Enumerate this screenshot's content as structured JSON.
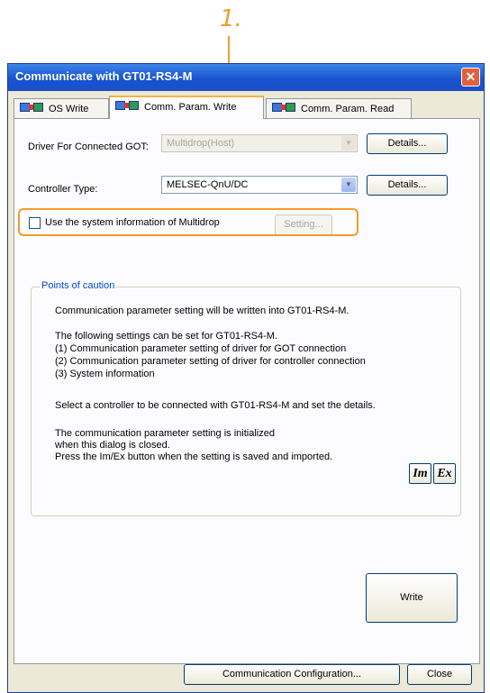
{
  "annotation": {
    "step": "1."
  },
  "window": {
    "title": "Communicate with GT01-RS4-M",
    "close_symbol": "✕"
  },
  "tabs": [
    {
      "label": "OS Write",
      "icon": "transfer-icon",
      "active": false
    },
    {
      "label": "Comm. Param. Write",
      "icon": "transfer-icon",
      "active": true
    },
    {
      "label": "Comm. Param. Read",
      "icon": "transfer-icon",
      "active": false
    }
  ],
  "driver": {
    "label": "Driver For Connected GOT:",
    "value": "Multidrop(Host)",
    "details_label": "Details..."
  },
  "controller": {
    "label": "Controller Type:",
    "value": "MELSEC-QnU/DC",
    "details_label": "Details..."
  },
  "system_info": {
    "checkbox_label": "Use the system information of Multidrop",
    "checked": false,
    "setting_label": "Setting..."
  },
  "caution": {
    "title": "Points of caution",
    "lines": [
      "Communication parameter setting will be written into GT01-RS4-M.",
      "The following settings can be set for GT01-RS4-M.",
      "(1) Communication parameter setting of driver for GOT connection",
      "(2) Communication parameter setting of driver for controller connection",
      "(3) System information",
      "Select a controller to be connected with GT01-RS4-M and set the details.",
      "The communication parameter setting is initialized",
      "when this dialog is closed.",
      "Press the Im/Ex button when the setting is saved and imported."
    ],
    "im_label": "Im",
    "ex_label": "Ex"
  },
  "write_label": "Write",
  "footer": {
    "comm_config_label": "Communication Configuration...",
    "close_label": "Close"
  },
  "colors": {
    "annotation": "#f39a2c",
    "titlebar": "#1953d0",
    "group_title": "#0046d5"
  }
}
